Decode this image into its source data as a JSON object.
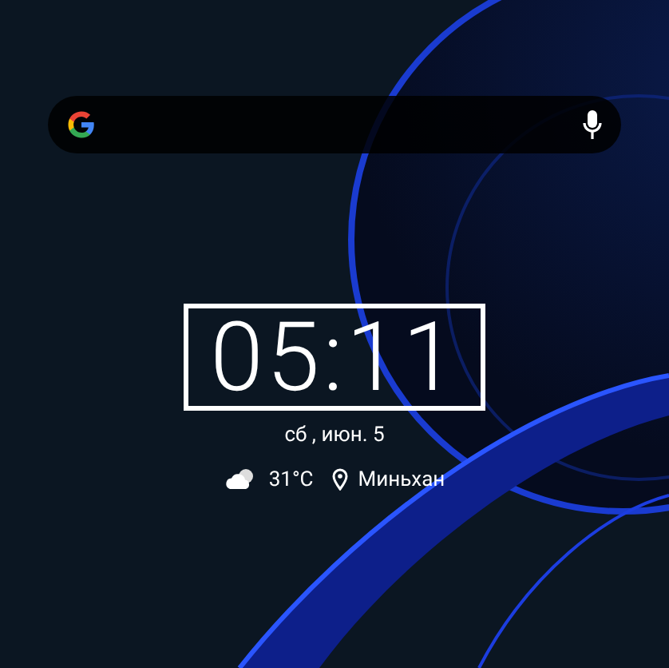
{
  "search_bar": {
    "voice_search": true
  },
  "clock": {
    "time": "05:11",
    "date": "сб , июн. 5"
  },
  "weather": {
    "temperature": "31°C",
    "location": "Миньхан"
  }
}
